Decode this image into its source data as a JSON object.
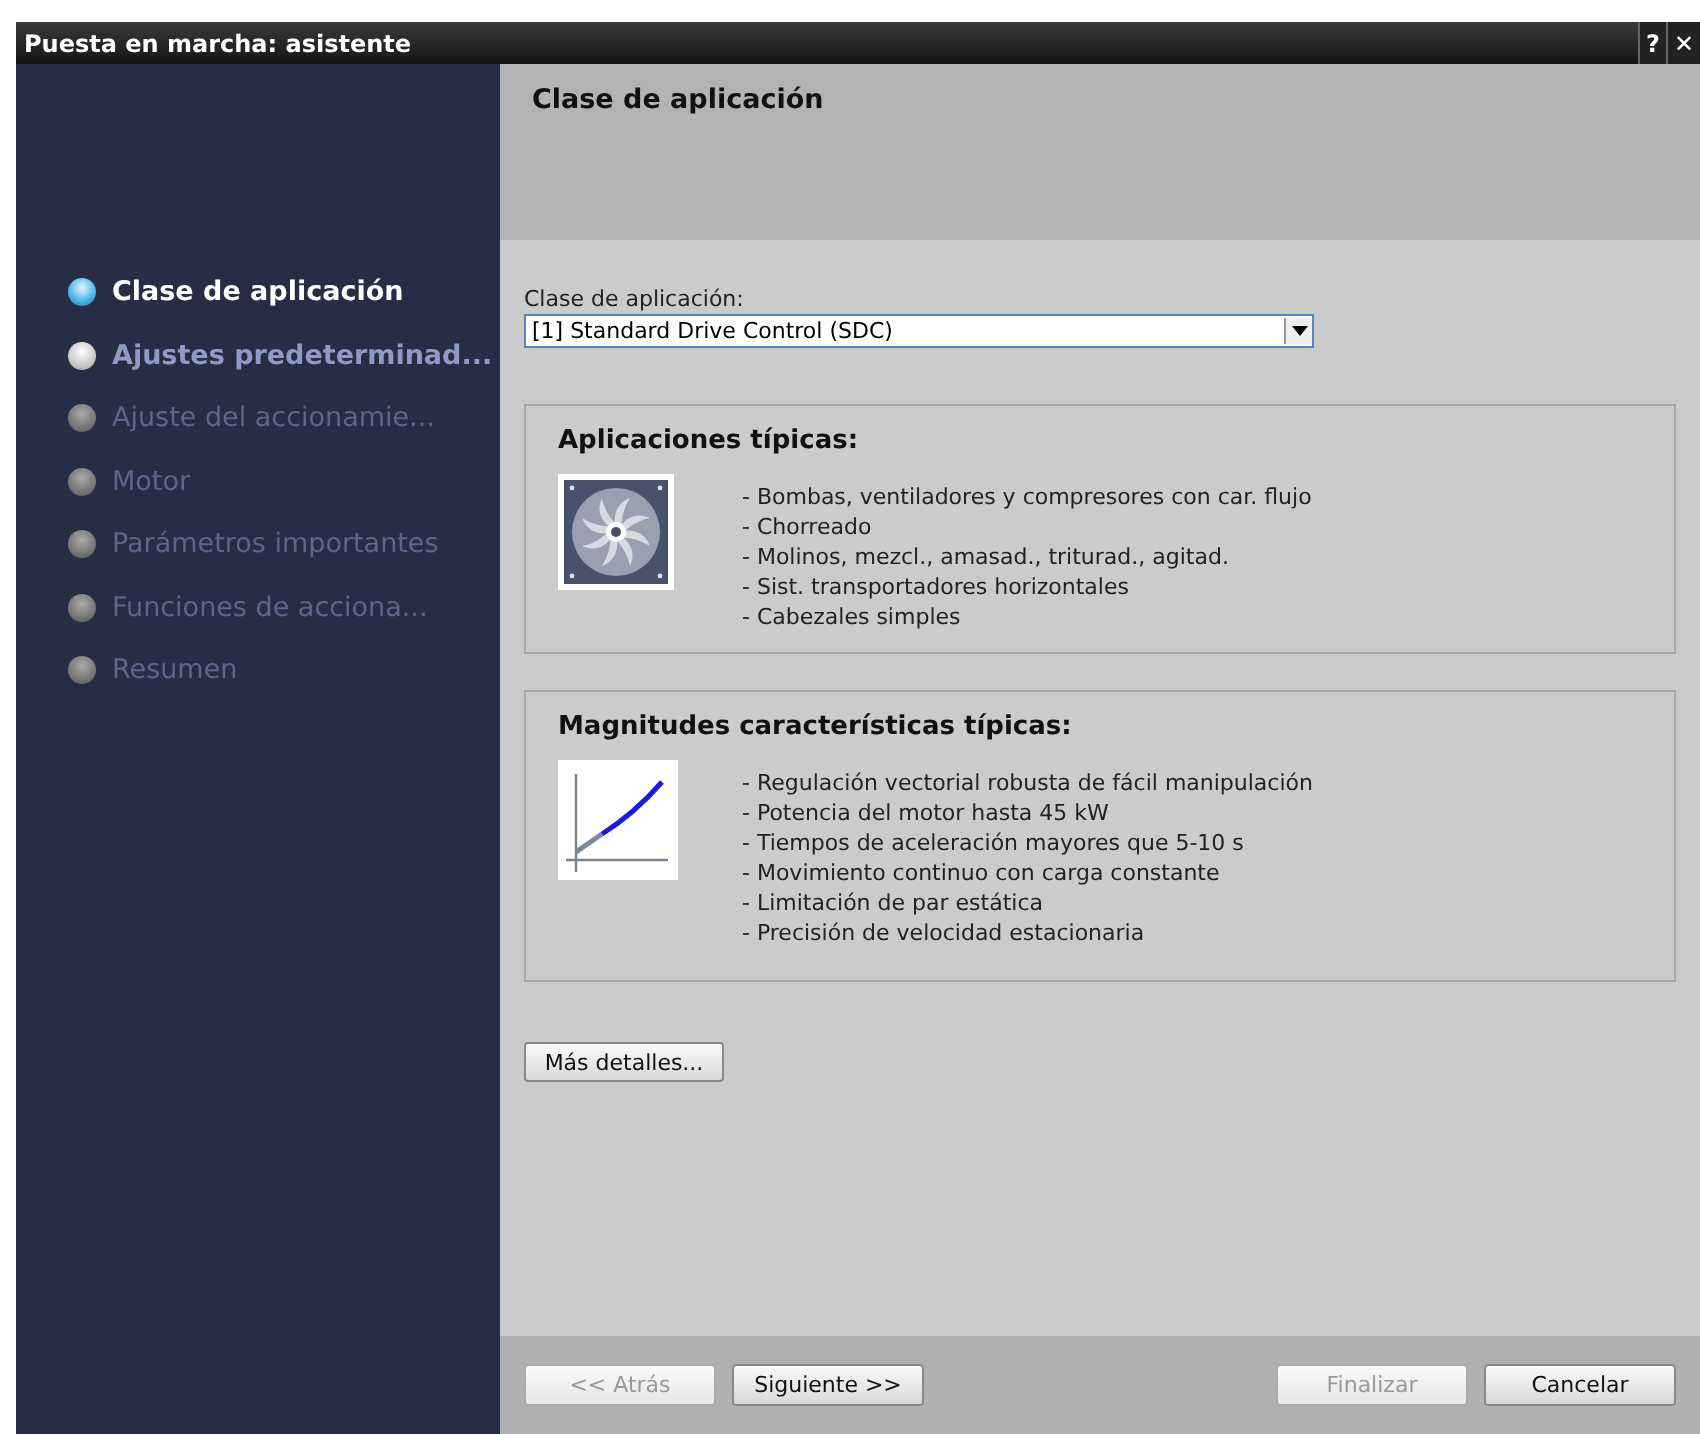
{
  "window": {
    "title": "Puesta en marcha: asistente",
    "controls": [
      "?",
      "✕"
    ]
  },
  "steps": [
    {
      "label": "Clase de aplicación",
      "selected": true,
      "disabled": false
    },
    {
      "label": "Ajustes predeterminad...",
      "selected": false,
      "disabled": false
    },
    {
      "label": "Ajuste del accionamie...",
      "selected": false,
      "disabled": true
    },
    {
      "label": "Motor",
      "selected": false,
      "disabled": true
    },
    {
      "label": "Parámetros importantes",
      "selected": false,
      "disabled": true
    },
    {
      "label": "Funciones de acciona...",
      "selected": false,
      "disabled": true
    },
    {
      "label": "Resumen",
      "selected": false,
      "disabled": true
    }
  ],
  "header": {
    "title": "Clase de aplicación"
  },
  "field": {
    "label": "Clase de aplicación:",
    "value": "[1] Standard Drive Control (SDC)"
  },
  "groups": [
    {
      "title": "Aplicaciones típicas:",
      "kind": "fan",
      "items": [
        "- Bombas, ventiladores y compresores con car. flujo",
        "- Chorreado",
        "- Molinos, mezcl., amasad., triturad., agitad.",
        "- Sist. transportadores horizontales",
        "- Cabezales simples"
      ]
    },
    {
      "title": "Magnitudes características típicas:",
      "kind": "curve",
      "items": [
        "- Regulación vectorial robusta de fácil manipulación",
        "- Potencia del motor hasta 45 kW",
        "- Tiempos de aceleración mayores que 5-10 s",
        "- Movimiento continuo con carga constante",
        "- Limitación de par estática",
        "- Precisión de velocidad estacionaria"
      ]
    }
  ],
  "details_button": "Más detalles...",
  "footer": {
    "left": [
      {
        "label": "<< Atrás",
        "disabled": true
      },
      {
        "label": "Siguiente >>",
        "disabled": false
      }
    ],
    "right": [
      {
        "label": "Finalizar",
        "disabled": true
      },
      {
        "label": "Cancelar",
        "disabled": false
      }
    ]
  }
}
